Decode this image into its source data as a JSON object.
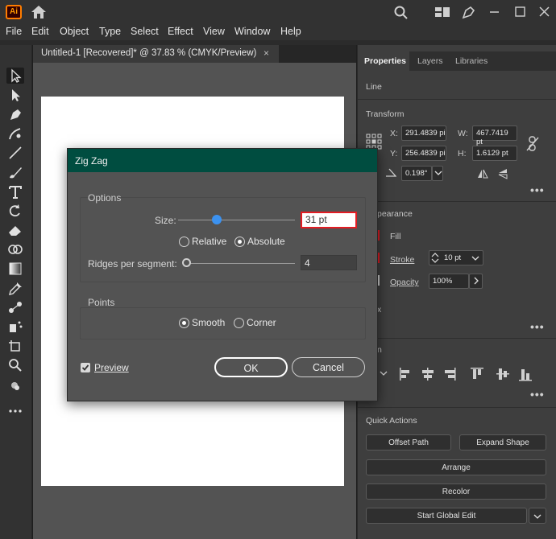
{
  "app": {
    "logo": "Ai"
  },
  "titlebar": {
    "icons": [
      "home-icon",
      "search-icon",
      "arrange-workspace-icon",
      "pen-nib-icon",
      "minimize-icon",
      "maximize-icon",
      "close-icon"
    ]
  },
  "menu": [
    "File",
    "Edit",
    "Object",
    "Type",
    "Select",
    "Effect",
    "View",
    "Window",
    "Help"
  ],
  "document": {
    "tab_label": "Untitled-1 [Recovered]* @ 37.83 % (CMYK/Preview)",
    "close": "×"
  },
  "panel": {
    "tabs": [
      "Properties",
      "Layers",
      "Libraries"
    ],
    "line_label": "Line",
    "transform_label": "Transform",
    "x_label": "X:",
    "x_value": "291.4839 pi",
    "y_label": "Y:",
    "y_value": "256.4839 pi",
    "w_label": "W:",
    "w_value": "467.7419 pt",
    "h_label": "H:",
    "h_value": "1.6129 pt",
    "angle_value": "0.198°",
    "appearance_label": "pearance",
    "fill_label": "Fill",
    "stroke_label": "Stroke",
    "stroke_weight": "10 pt",
    "opacity_label": "Opacity",
    "opacity_value": "100%",
    "fx_label": "x",
    "align_label": "n",
    "quick_actions_label": "Quick Actions",
    "offset_path": "Offset Path",
    "expand_shape": "Expand Shape",
    "arrange": "Arrange",
    "recolor": "Recolor",
    "start_global_edit": "Start Global Edit",
    "more": "•••"
  },
  "dialog": {
    "title": "Zig Zag",
    "options_label": "Options",
    "size_label": "Size:",
    "size_value": "31 pt",
    "size_slider_fraction": 0.31,
    "relative_label": "Relative",
    "absolute_label": "Absolute",
    "ridges_label": "Ridges per segment:",
    "ridges_value": "4",
    "ridges_slider_fraction": 0.0,
    "points_label": "Points",
    "smooth_label": "Smooth",
    "corner_label": "Corner",
    "preview_label": "Preview",
    "preview_checked": true,
    "ok_label": "OK",
    "cancel_label": "Cancel",
    "colors": {
      "title_bar": "#004d40",
      "highlight": "#e31c23",
      "slider_knob": "#3c92f0"
    }
  }
}
